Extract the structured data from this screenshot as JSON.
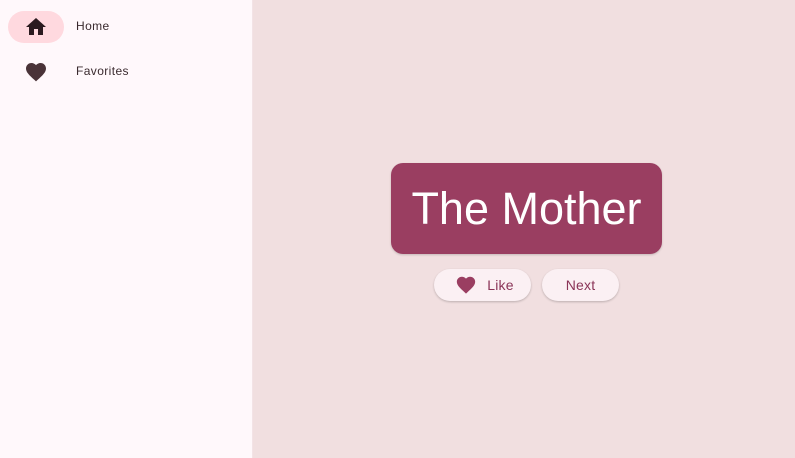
{
  "nav": {
    "items": [
      {
        "label": "Home",
        "icon": "home-icon",
        "selected": true
      },
      {
        "label": "Favorites",
        "icon": "heart-icon",
        "selected": false
      }
    ]
  },
  "main": {
    "current_pair": "The Mother",
    "like_label": "Like",
    "next_label": "Next"
  },
  "colors": {
    "rail_background": "#fff8fb",
    "main_background": "#f1dfe0",
    "card_background": "#9a3e61",
    "selected_indicator": "#ffd9df",
    "button_background": "#fbf0f3",
    "button_text": "#8a3457",
    "nav_icon": "#4a3338"
  }
}
